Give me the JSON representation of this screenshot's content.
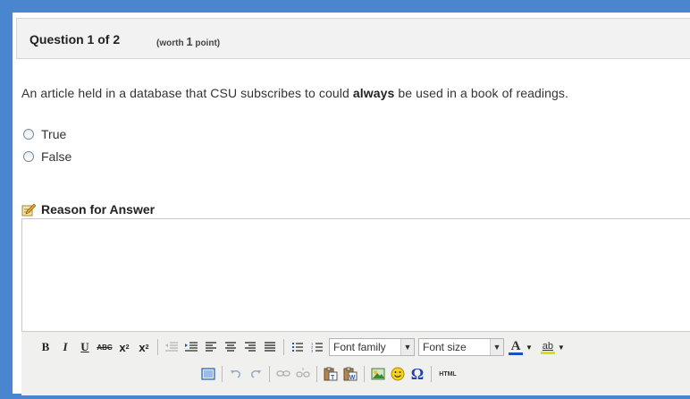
{
  "question": {
    "title": "Question 1 of 2",
    "worth_prefix": "(worth",
    "worth_points": "1",
    "worth_suffix": "point)",
    "text_before": "An article held in a database that CSU subscribes to could ",
    "text_bold": "always",
    "text_after": " be used in a book of readings."
  },
  "options": [
    {
      "label": "True"
    },
    {
      "label": "False"
    }
  ],
  "reason": {
    "label": "Reason for Answer",
    "icon": "pencil-note-icon"
  },
  "editor": {
    "value": ""
  },
  "toolbar": {
    "bold": "B",
    "italic": "I",
    "underline": "U",
    "strike": "ABC",
    "subscript": "x",
    "superscript": "x",
    "font_family": "Font family",
    "font_size": "Font size",
    "forecolor": "A",
    "backcolor": "ab",
    "omega": "Ω",
    "html": "HTML"
  },
  "colors": {
    "frame": "#4a86d0",
    "header_bg": "#f2f2f2",
    "toolbar_bg": "#f0f0ee",
    "forecolor_bar": "#1f4fbf",
    "backcolor_bar": "#e0e000"
  }
}
